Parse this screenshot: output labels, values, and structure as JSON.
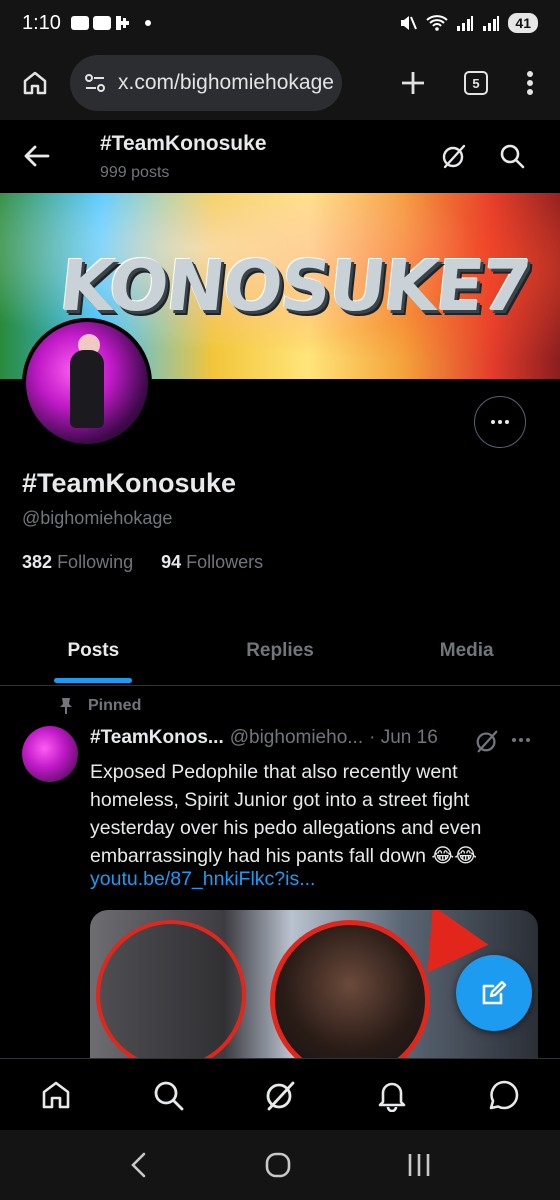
{
  "status_bar": {
    "time": "1:10",
    "battery": "41"
  },
  "browser": {
    "url": "x.com/bighomiehokage",
    "tab_count": "5"
  },
  "header": {
    "title": "#TeamKonosuke",
    "post_count": "999 posts"
  },
  "banner": {
    "text": "KONOSUKE7"
  },
  "profile": {
    "name": "#TeamKonosuke",
    "handle": "@bighomiehokage",
    "following_count": "382",
    "following_label": "Following",
    "followers_count": "94",
    "followers_label": "Followers"
  },
  "tabs": [
    {
      "label": "Posts",
      "active": true
    },
    {
      "label": "Replies",
      "active": false
    },
    {
      "label": "Media",
      "active": false
    }
  ],
  "post": {
    "pinned_label": "Pinned",
    "author_name": "#TeamKonos...",
    "author_handle": "@bighomieho...",
    "date": "· Jun 16",
    "text": "Exposed Pedophile that also recently went homeless, Spirit Junior got into a street fight yesterday over his pedo allegations and even embarrassingly had his pants fall down 😂😂",
    "link": "youtu.be/87_hnkiFlkc?is..."
  },
  "colors": {
    "accent": "#1d9bf0",
    "background": "#000000",
    "muted": "#71767b"
  },
  "icons": {
    "status": [
      "youtube-icon",
      "youtube-icon",
      "kick-icon",
      "mute-icon",
      "wifi-icon",
      "signal-icon",
      "signal-icon"
    ],
    "nav": [
      "home-icon",
      "search-icon",
      "grok-icon",
      "notifications-icon",
      "messages-icon"
    ]
  }
}
